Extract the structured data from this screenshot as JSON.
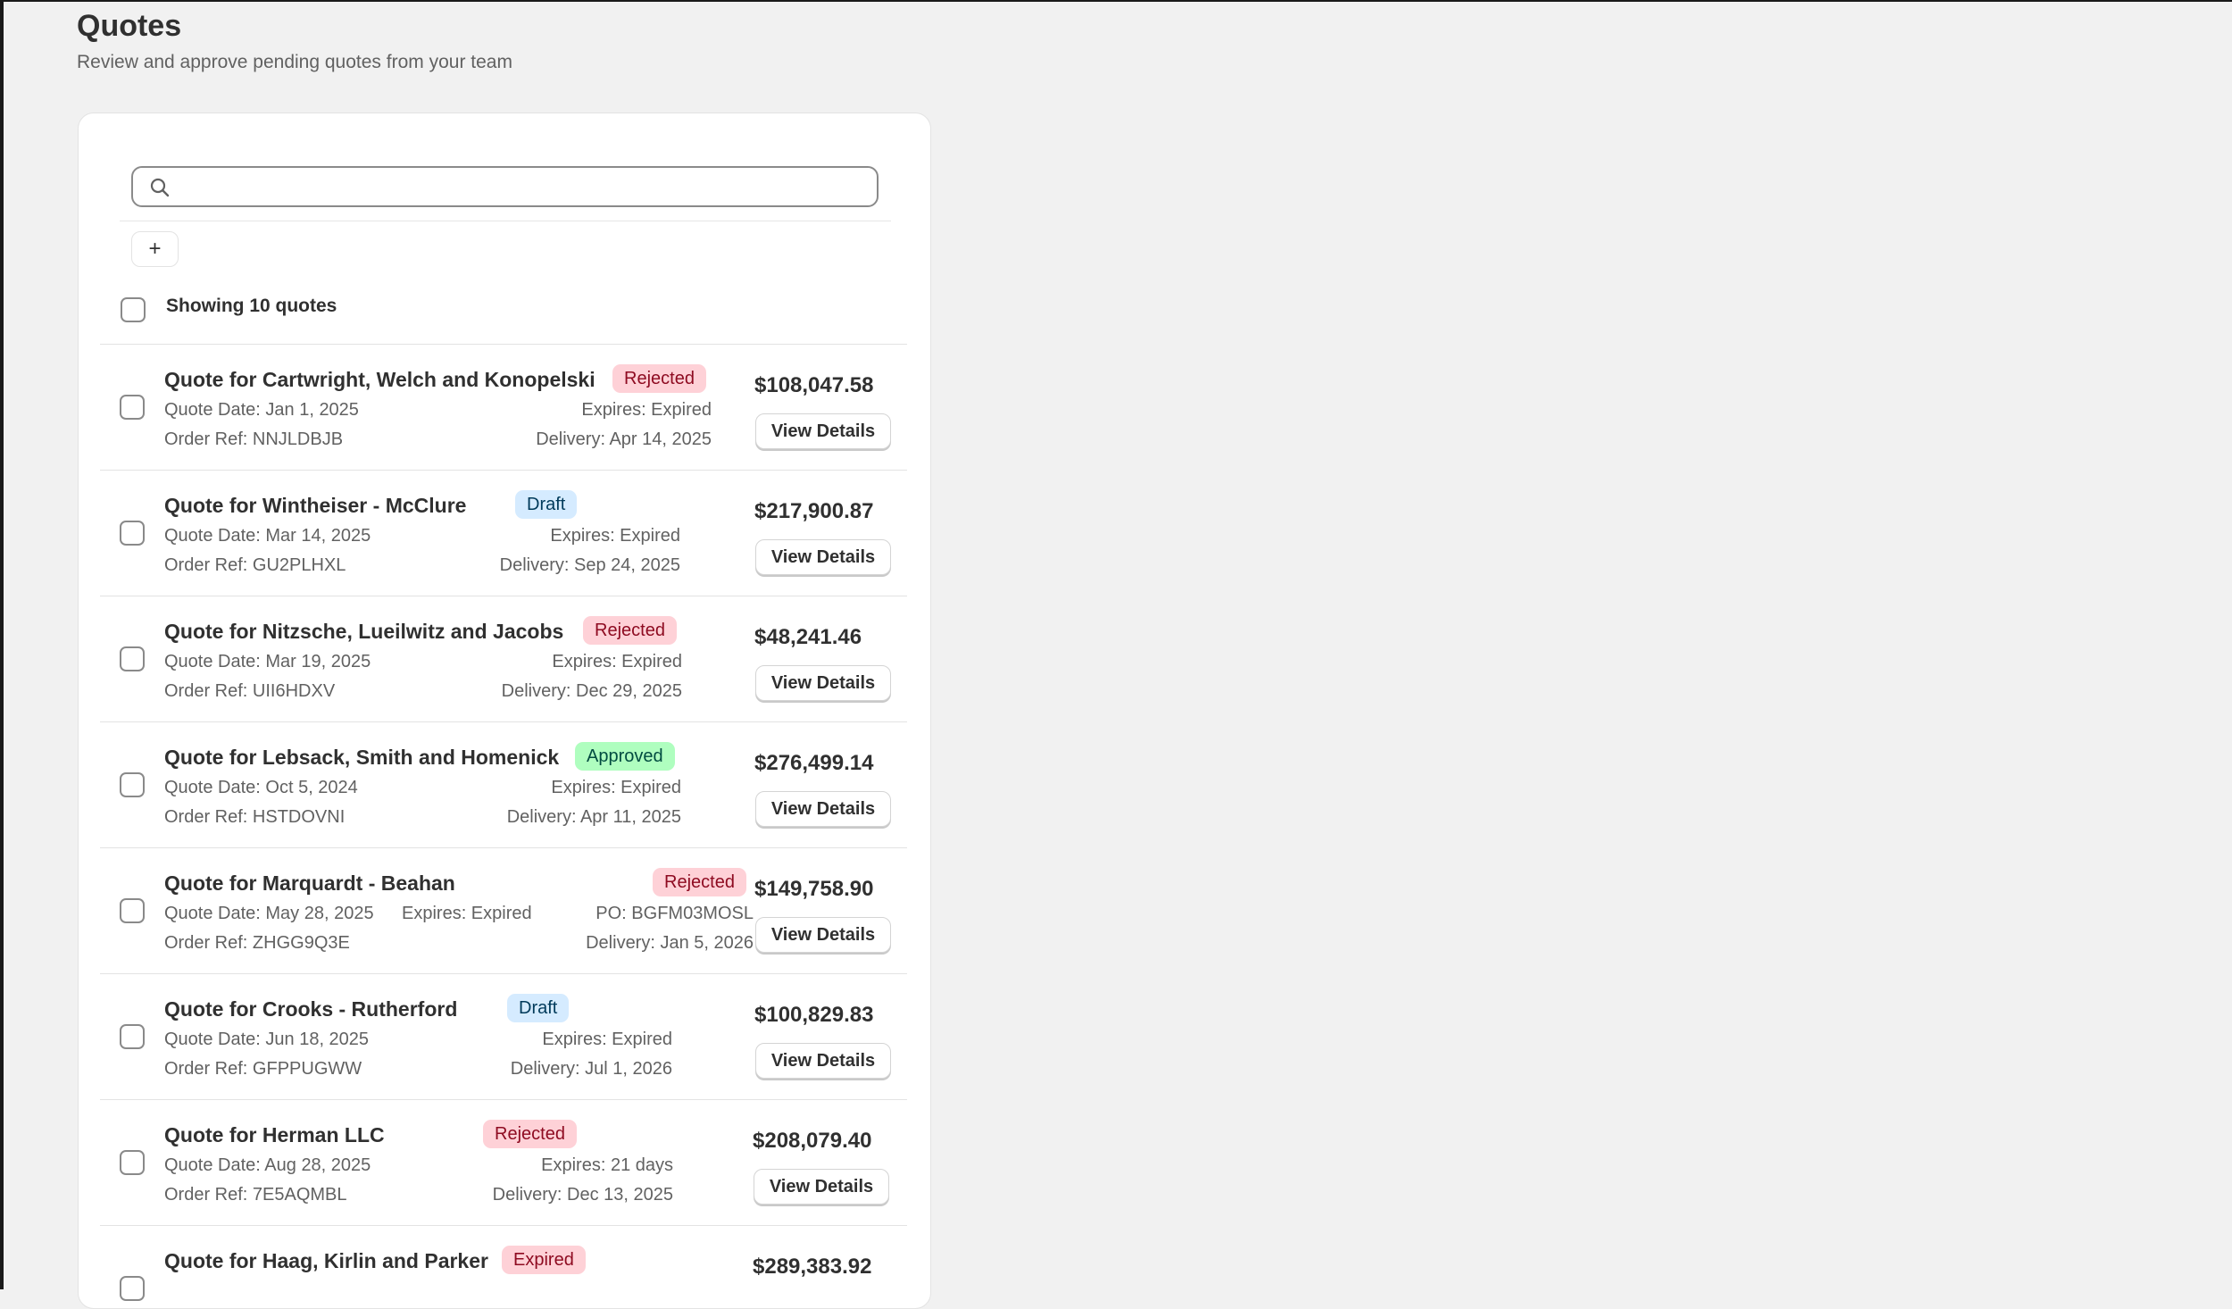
{
  "page": {
    "title": "Quotes",
    "subtitle": "Review and approve pending quotes from your team"
  },
  "search": {
    "value": "",
    "placeholder": ""
  },
  "toolbar": {
    "add_label": "+"
  },
  "list": {
    "showing_label": "Showing 10 quotes",
    "view_details_label": "View Details",
    "quotes": [
      {
        "title": "Quote for Cartwright, Welch and Konopelski",
        "status": "Rejected",
        "quote_date": "Quote Date: Jan 1, 2025",
        "expires": "Expires: Expired",
        "order_ref": "Order Ref: NNJLDBJB",
        "delivery": "Delivery: Apr 14, 2025",
        "amount": "$108,047.58"
      },
      {
        "title": "Quote for Wintheiser - McClure",
        "status": "Draft",
        "quote_date": "Quote Date: Mar 14, 2025",
        "expires": "Expires: Expired",
        "order_ref": "Order Ref: GU2PLHXL",
        "delivery": "Delivery: Sep 24, 2025",
        "amount": "$217,900.87"
      },
      {
        "title": "Quote for Nitzsche, Lueilwitz and Jacobs",
        "status": "Rejected",
        "quote_date": "Quote Date: Mar 19, 2025",
        "expires": "Expires: Expired",
        "order_ref": "Order Ref: UII6HDXV",
        "delivery": "Delivery: Dec 29, 2025",
        "amount": "$48,241.46"
      },
      {
        "title": "Quote for Lebsack, Smith and Homenick",
        "status": "Approved",
        "quote_date": "Quote Date: Oct 5, 2024",
        "expires": "Expires: Expired",
        "order_ref": "Order Ref: HSTDOVNI",
        "delivery": "Delivery: Apr 11, 2025",
        "amount": "$276,499.14"
      },
      {
        "title": "Quote for Marquardt - Beahan",
        "status": "Rejected",
        "quote_date": "Quote Date: May 28, 2025",
        "expires": "Expires: Expired",
        "po": "PO: BGFM03MOSL",
        "order_ref": "Order Ref: ZHGG9Q3E",
        "delivery": "Delivery: Jan 5, 2026",
        "amount": "$149,758.90"
      },
      {
        "title": "Quote for Crooks - Rutherford",
        "status": "Draft",
        "quote_date": "Quote Date: Jun 18, 2025",
        "expires": "Expires: Expired",
        "order_ref": "Order Ref: GFPPUGWW",
        "delivery": "Delivery: Jul 1, 2026",
        "amount": "$100,829.83"
      },
      {
        "title": "Quote for Herman LLC",
        "status": "Rejected",
        "quote_date": "Quote Date: Aug 28, 2025",
        "expires": "Expires: 21 days",
        "order_ref": "Order Ref: 7E5AQMBL",
        "delivery": "Delivery: Dec 13, 2025",
        "amount": "$208,079.40"
      },
      {
        "title": "Quote for Haag, Kirlin and Parker",
        "status": "Expired",
        "quote_date": "",
        "expires": "",
        "order_ref": "",
        "delivery": "",
        "amount": "$289,383.92"
      }
    ]
  }
}
